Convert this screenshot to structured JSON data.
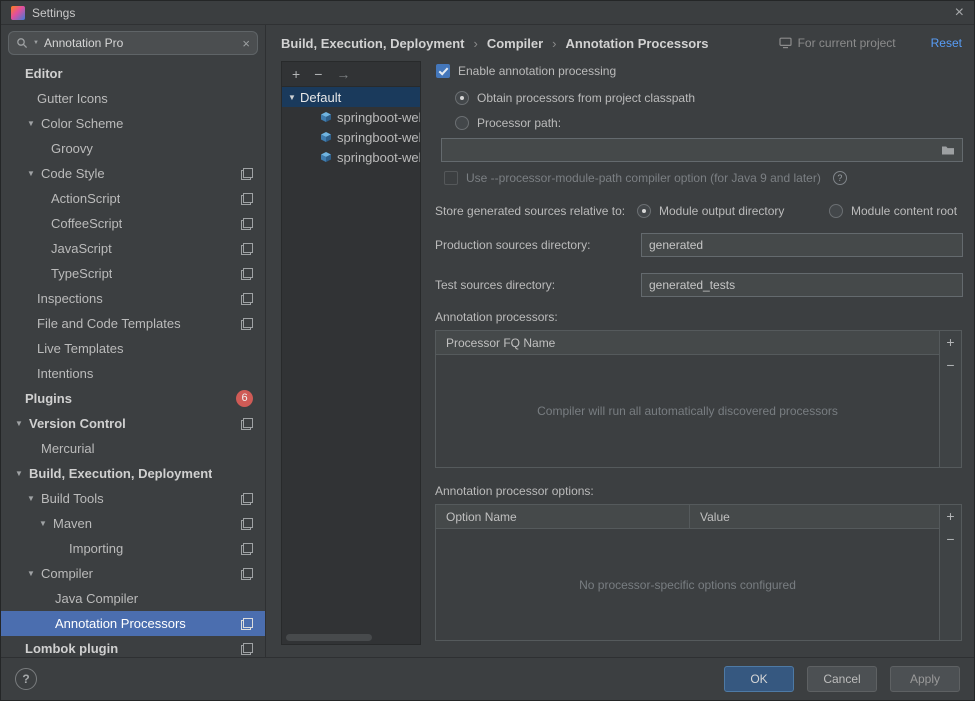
{
  "titlebar": {
    "title": "Settings",
    "close_glyph": "×"
  },
  "sidebar": {
    "search_value": "Annotation Pro",
    "clear_glyph": "×",
    "items": [
      {
        "label": "Editor",
        "pad": 24,
        "bold": true
      },
      {
        "label": "Gutter Icons",
        "pad": 36
      },
      {
        "label": "Color Scheme",
        "pad": 40,
        "arrow": true
      },
      {
        "label": "Groovy",
        "pad": 50
      },
      {
        "label": "Code Style",
        "pad": 40,
        "arrow": true,
        "gear": true
      },
      {
        "label": "ActionScript",
        "pad": 50,
        "gear": true
      },
      {
        "label": "CoffeeScript",
        "pad": 50,
        "gear": true
      },
      {
        "label": "JavaScript",
        "pad": 50,
        "gear": true
      },
      {
        "label": "TypeScript",
        "pad": 50,
        "gear": true
      },
      {
        "label": "Inspections",
        "pad": 36,
        "gear": true
      },
      {
        "label": "File and Code Templates",
        "pad": 36,
        "gear": true
      },
      {
        "label": "Live Templates",
        "pad": 36
      },
      {
        "label": "Intentions",
        "pad": 36
      },
      {
        "label": "Plugins",
        "pad": 24,
        "bold": true,
        "badge": "6"
      },
      {
        "label": "Version Control",
        "pad": 28,
        "arrow": true,
        "bold": true,
        "gear": true
      },
      {
        "label": "Mercurial",
        "pad": 40
      },
      {
        "label": "Build, Execution, Deployment",
        "pad": 28,
        "arrow": true,
        "bold": true
      },
      {
        "label": "Build Tools",
        "pad": 40,
        "arrow": true,
        "gear": true
      },
      {
        "label": "Maven",
        "pad": 52,
        "arrow": true,
        "gear": true
      },
      {
        "label": "Importing",
        "pad": 68,
        "gear": true
      },
      {
        "label": "Compiler",
        "pad": 40,
        "arrow": true,
        "gear": true
      },
      {
        "label": "Java Compiler",
        "pad": 54
      },
      {
        "label": "Annotation Processors",
        "pad": 54,
        "gear": true,
        "selected": true
      },
      {
        "label": "Lombok plugin",
        "pad": 24,
        "bold": true,
        "gear": true
      }
    ]
  },
  "header": {
    "breadcrumbs": [
      "Build, Execution, Deployment",
      "Compiler",
      "Annotation Processors"
    ],
    "separator": "›",
    "scope_label": "For current project",
    "reset_label": "Reset"
  },
  "profiles": {
    "toolbar": {
      "add": "+",
      "remove": "−",
      "move": "→"
    },
    "default_label": "Default",
    "modules": [
      "springboot-web",
      "springboot-web",
      "springboot-web"
    ]
  },
  "form": {
    "enable_label": "Enable annotation processing",
    "obtain_label": "Obtain processors from project classpath",
    "processor_path_label": "Processor path:",
    "processor_path_value": "",
    "module_path_label": "Use --processor-module-path compiler option (for Java 9 and later)",
    "help_glyph": "?",
    "store_label": "Store generated sources relative to:",
    "module_output_label": "Module output directory",
    "module_content_label": "Module content root",
    "production_label": "Production sources directory:",
    "production_value": "generated",
    "test_label": "Test sources directory:",
    "test_value": "generated_tests",
    "processors_label": "Annotation processors:",
    "processors_table": {
      "header": "Processor FQ Name",
      "empty": "Compiler will run all automatically discovered processors",
      "add": "+",
      "remove": "−"
    },
    "options_label": "Annotation processor options:",
    "options_table": {
      "col1": "Option Name",
      "col2": "Value",
      "empty": "No processor-specific options configured",
      "add": "+",
      "remove": "−"
    }
  },
  "footer": {
    "help_glyph": "?",
    "ok": "OK",
    "cancel": "Cancel",
    "apply": "Apply"
  },
  "colors": {
    "sidebar_selection": "#4b6eaf",
    "profile_selection": "#1a3a5c",
    "link_blue": "#589df6",
    "badge_red": "#cf5b56",
    "ok_button_bg": "#365880",
    "checkbox_blue": "#4477bb"
  }
}
